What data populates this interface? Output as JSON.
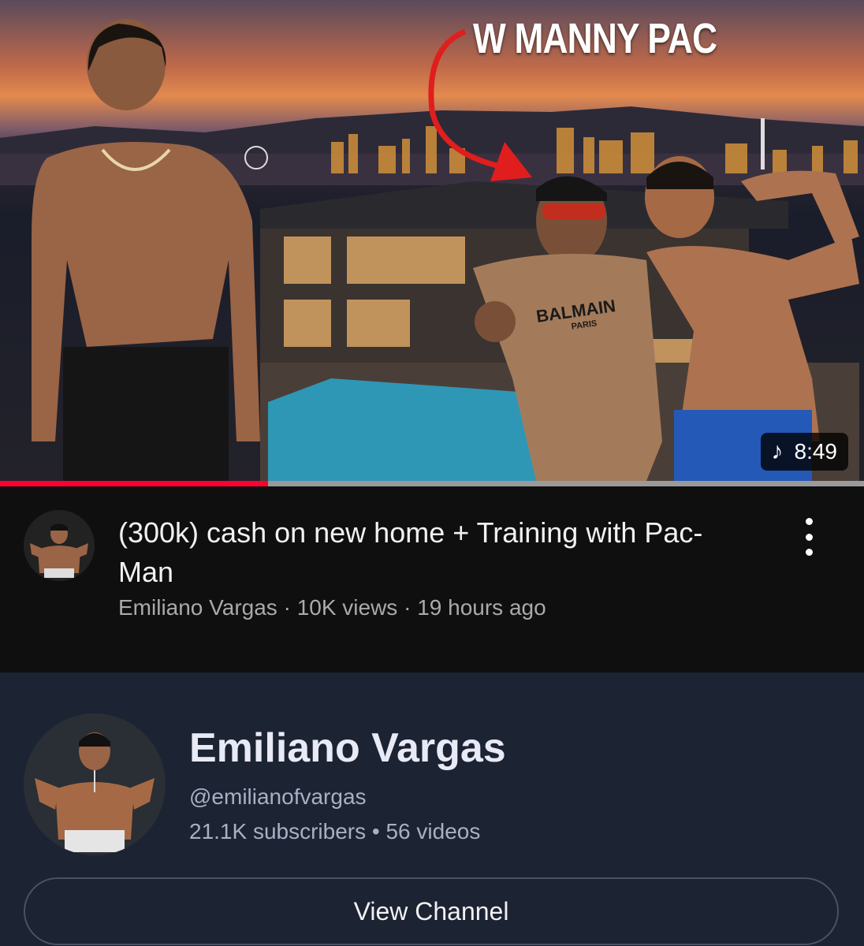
{
  "thumbnail": {
    "overlay_text": "W MANNY PAC",
    "shirt_text": "BALMAIN",
    "shirt_subtext": "PARIS",
    "duration": "8:49",
    "duration_icon": "music-note-icon",
    "watch_progress": 0.31
  },
  "video": {
    "title": "(300k) cash on new home + Training with Pac-Man",
    "channel": "Emiliano Vargas",
    "views": "10K views",
    "age": "19 hours ago",
    "separator": "·",
    "menu_icon": "more-vert-icon"
  },
  "channel_card": {
    "name": "Emiliano Vargas",
    "handle": "@emilianofvargas",
    "subscribers": "21.1K subscribers",
    "videos": "56 videos",
    "separator": "•",
    "button_label": "View Channel"
  },
  "colors": {
    "progress": "#ff0033",
    "card_background": "#1c2333",
    "page_background": "#0f0f0f"
  }
}
